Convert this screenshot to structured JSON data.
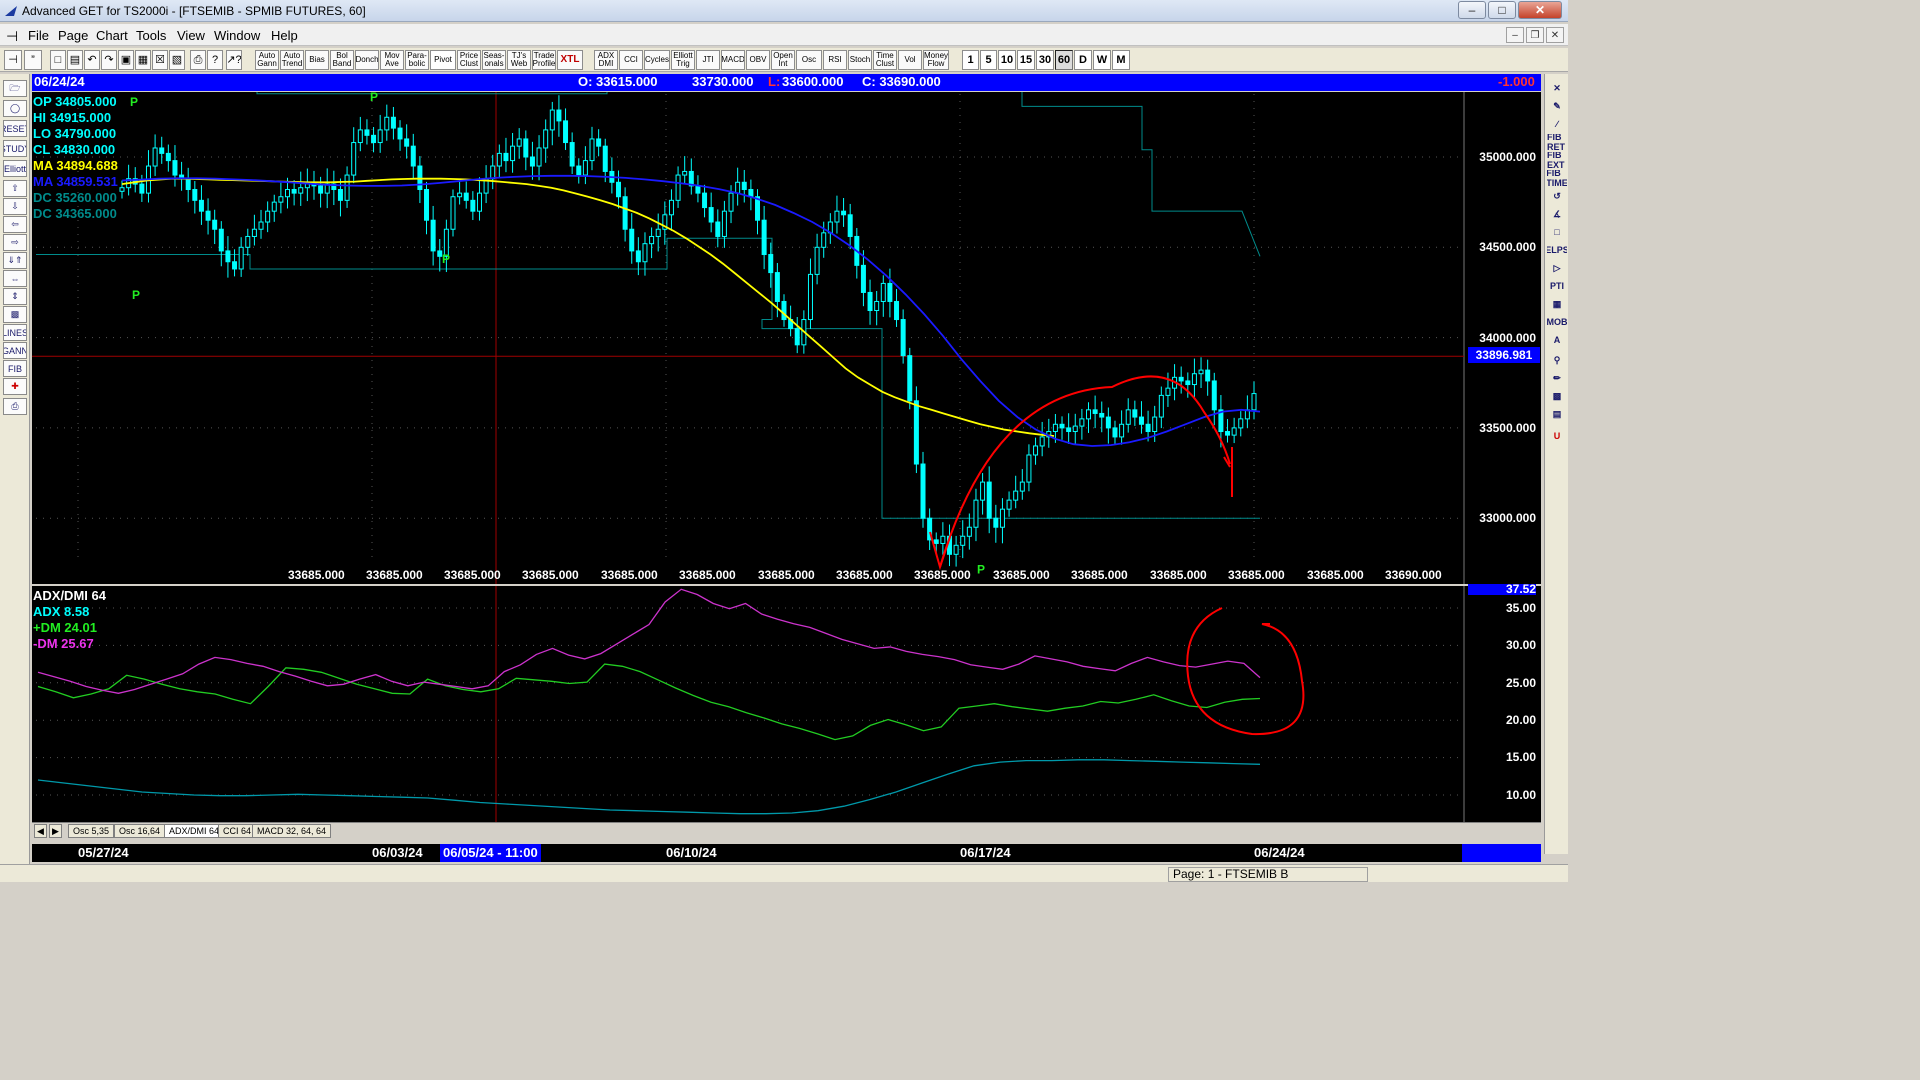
{
  "window": {
    "title": "Advanced GET for TS2000i - [FTSEMIB - SPMIB FUTURES, 60]",
    "controls": [
      "minimize",
      "maximize",
      "close"
    ]
  },
  "menu": {
    "items": [
      "File",
      "Page",
      "Chart",
      "Tools",
      "View",
      "Window",
      "Help"
    ]
  },
  "toolbar": {
    "study_buttons": [
      "Auto Gann",
      "Auto Trend",
      "Bias",
      "Bol Band",
      "Donch",
      "Mov Ave",
      "Para-bolic",
      "Pivot",
      "Price Clust",
      "Seas-onals",
      "TJ's Web",
      "Trade Profile",
      "XTL",
      "ADX DMI",
      "CCI",
      "Cycles",
      "Elliott Trig",
      "JTI",
      "MACD",
      "OBV",
      "Open Int",
      "Osc",
      "RSI",
      "Stoch",
      "Time Clust",
      "Vol",
      "Money Flow"
    ],
    "timeframes": [
      "1",
      "5",
      "10",
      "15",
      "30",
      "60",
      "D",
      "W",
      "M"
    ],
    "active_timeframe": "60"
  },
  "chart_header": {
    "date": "06/24/24",
    "open": "O: 33615.000",
    "high": "33730.000",
    "low_prefix": "L:",
    "low": "33600.000",
    "close": "C: 33690.000",
    "change": "-1.000"
  },
  "price_legend": [
    {
      "label": "OP  34805.000",
      "color": "#00ffff"
    },
    {
      "label": "HI   34915.000",
      "color": "#00ffff"
    },
    {
      "label": "LO   34790.000",
      "color": "#00ffff"
    },
    {
      "label": "CL   34830.000",
      "color": "#00ffff"
    },
    {
      "label": "MA  34894.688",
      "color": "#ffff00"
    },
    {
      "label": "MA  34859.531",
      "color": "#1a1aff"
    },
    {
      "label": "DC  35260.000",
      "color": "#008b8b"
    },
    {
      "label": "DC  34365.000",
      "color": "#008b8b"
    }
  ],
  "price_axis": {
    "labels": [
      "35000.000",
      "34500.000",
      "34000.000",
      "33500.000",
      "33000.000"
    ],
    "cursor_value": "33896.981"
  },
  "price_bottom_labels": [
    "33685.000",
    "33685.000",
    "33685.000",
    "33685.000",
    "33685.000",
    "33685.000",
    "33685.000",
    "33685.000",
    "33685.000",
    "33685.000",
    "33685.000",
    "33685.000",
    "33685.000",
    "33685.000",
    "33685.000",
    "33690.000"
  ],
  "pivot_marker": "P",
  "indicator": {
    "title": "ADX/DMI 64",
    "adx_label": "ADX 8.58",
    "pdm_label": "+DM 24.01",
    "mdm_label": "-DM  25.67",
    "top_value": "37.52",
    "axis_labels": [
      "35.00",
      "30.00",
      "25.00",
      "20.00",
      "15.00",
      "10.00"
    ]
  },
  "tabs": [
    "Osc 5,35",
    "Osc 16,64",
    "ADX/DMI 64",
    "CCI 64",
    "MACD 32, 64, 64"
  ],
  "active_tab": "ADX/DMI 64",
  "dates": {
    "labels": [
      "05/27/24",
      "06/03/24",
      "06/10/24",
      "06/17/24",
      "06/24/24"
    ],
    "cursor": "06/05/24 - 11:00"
  },
  "status": {
    "page": "Page: 1 - FTSEMIB B"
  },
  "colors": {
    "chart_bg": "#000000",
    "header_bg": "#0000ff",
    "candles": "#00ffff",
    "ma_fast": "#ffff00",
    "ma_slow": "#1a1aff",
    "donchian": "#008b8b",
    "plus_dm": "#22cc22",
    "minus_dm": "#cc33cc",
    "adx": "#0099aa",
    "annotation": "#ff0000"
  },
  "chart_data": [
    {
      "type": "candlestick",
      "title": "FTSEMIB - SPMIB FUTURES, 60",
      "ylim": [
        32700,
        35500
      ],
      "yticks": [
        33000,
        33500,
        34000,
        34500,
        35000
      ],
      "xticks": [
        "05/27/24",
        "06/03/24",
        "06/10/24",
        "06/17/24",
        "06/24/24"
      ],
      "series": [
        {
          "name": "Close",
          "values": [
            34830,
            34880,
            34850,
            34800,
            34950,
            35050,
            35020,
            34980,
            34900,
            34880,
            34820,
            34760,
            34700,
            34650,
            34600,
            34480,
            34420,
            34380,
            34500,
            34560,
            34600,
            34640,
            34700,
            34750,
            34780,
            34820,
            34800,
            34830,
            34860,
            34840,
            34800,
            34850,
            34820,
            34760,
            34900,
            35080,
            35150,
            35120,
            35080,
            35150,
            35220,
            35160,
            35100,
            35060,
            34950,
            34820,
            34650,
            34480,
            34450,
            34600,
            34780,
            34800,
            34760,
            34700,
            34800,
            34880,
            34950,
            35020,
            34980,
            35060,
            35100,
            35000,
            34950,
            35050,
            35150,
            35260,
            35200,
            35080,
            34950,
            34900,
            34980,
            35100,
            35060,
            34920,
            34860,
            34780,
            34600,
            34480,
            34420,
            34520,
            34560,
            34600,
            34680,
            34760,
            34900,
            34920,
            34840,
            34800,
            34720,
            34640,
            34560,
            34700,
            34800,
            34860,
            34820,
            34780,
            34650,
            34460,
            34360,
            34200,
            34100,
            34050,
            33960,
            34100,
            34350,
            34500,
            34580,
            34640,
            34700,
            34680,
            34560,
            34400,
            34250,
            34150,
            34200,
            34300,
            34200,
            34100,
            33900,
            33650,
            33300,
            33000,
            32880,
            32860,
            32900,
            32800,
            32850,
            32900,
            32950,
            33100,
            33200,
            33000,
            32950,
            33050,
            33100,
            33150,
            33200,
            33350,
            33400,
            33450,
            33480,
            33520,
            33500,
            33480,
            33510,
            33550,
            33600,
            33580,
            33560,
            33500,
            33450,
            33520,
            33600,
            33560,
            33520,
            33480,
            33560,
            33680,
            33720,
            33780,
            33760,
            33740,
            33800,
            33820,
            33760,
            33600,
            33480,
            33460,
            33500,
            33550,
            33600,
            33690
          ]
        },
        {
          "name": "MA 34894.688",
          "values": [
            34850,
            34860,
            34870,
            34875,
            34880,
            34880,
            34878,
            34876,
            34874,
            34872,
            34870,
            34868,
            34866,
            34864,
            34862,
            34860,
            34860,
            34860,
            34862,
            34864,
            34868,
            34872,
            34876,
            34878,
            34880,
            34880,
            34880,
            34878,
            34876,
            34872,
            34868,
            34862,
            34856,
            34850,
            34840,
            34830,
            34815,
            34798,
            34780,
            34760,
            34740,
            34715,
            34690,
            34660,
            34625,
            34590,
            34550,
            34505,
            34460,
            34410,
            34355,
            34300,
            34245,
            34190,
            34130,
            34070,
            34010,
            33950,
            33890,
            33830,
            33780,
            33740,
            33700,
            33670,
            33645,
            33620,
            33600,
            33580,
            33560,
            33540,
            33520,
            33505,
            33490,
            33480,
            33470,
            33462,
            33455
          ]
        },
        {
          "name": "MA 34859.531",
          "values": [
            34870,
            34875,
            34880,
            34882,
            34882,
            34880,
            34876,
            34872,
            34866,
            34860,
            34852,
            34846,
            34842,
            34840,
            34840,
            34842,
            34848,
            34856,
            34866,
            34876,
            34884,
            34890,
            34894,
            34896,
            34896,
            34894,
            34890,
            34884,
            34876,
            34866,
            34854,
            34840,
            34822,
            34800,
            34770,
            34735,
            34690,
            34640,
            34580,
            34510,
            34430,
            34340,
            34240,
            34130,
            34010,
            33880,
            33760,
            33650,
            33560,
            33490,
            33440,
            33410,
            33400,
            33405,
            33420,
            33445,
            33480,
            33520,
            33560,
            33590,
            33600,
            33590
          ]
        }
      ]
    },
    {
      "type": "line",
      "title": "ADX/DMI 64",
      "ylim": [
        7,
        37.52
      ],
      "yticks": [
        10,
        15,
        20,
        25,
        30,
        35
      ],
      "series": [
        {
          "name": "+DM 24.01",
          "values": [
            24.5,
            23.8,
            23,
            23.5,
            24.2,
            26,
            25.5,
            24.8,
            24.2,
            23.8,
            23.5,
            22.8,
            22.2,
            24.5,
            27,
            26.8,
            26.4,
            25.6,
            24.8,
            24.2,
            23.6,
            23.5,
            25.5,
            24.6,
            24.1,
            23.8,
            24.2,
            25.6,
            25.4,
            25.2,
            24.9,
            25.1,
            27.5,
            27.2,
            26.5,
            25.4,
            24.3,
            23.3,
            22.4,
            21.8,
            21,
            20.3,
            19.5,
            18.9,
            18.2,
            17.4,
            17.9,
            19.3,
            20.1,
            19.4,
            18.6,
            19.1,
            21.6,
            21.9,
            22.2,
            21.8,
            21.5,
            21.2,
            21.6,
            21.9,
            22.5,
            22.3,
            22.8,
            23.4,
            22.6,
            21.9,
            21.7,
            22.4,
            22.8,
            22.9
          ]
        },
        {
          "name": "-DM  25.67",
          "values": [
            26.4,
            25.8,
            25.2,
            24.5,
            24,
            23.6,
            24.1,
            24.8,
            25.5,
            26.2,
            27.5,
            28.4,
            28.1,
            27.6,
            27.2,
            26.5,
            25.9,
            25.2,
            24.6,
            24.8,
            25.5,
            26.1,
            25.2,
            24.6,
            25.1,
            24.8,
            24.5,
            24.2,
            24.6,
            26.5,
            27.4,
            28.8,
            29.6,
            28.7,
            28.2,
            28.9,
            30.2,
            31.5,
            32.8,
            35.8,
            37.5,
            36.8,
            35.6,
            34.9,
            35.6,
            34.2,
            33.5,
            32.9,
            32.4,
            31.6,
            30.8,
            30.2,
            29.6,
            29.8,
            29.2,
            28.8,
            28.5,
            28.1,
            27.4,
            27.1,
            26.8,
            27.5,
            28.6,
            28.2,
            27.8,
            27.2,
            26.9,
            26.6,
            27.6,
            28.4,
            27.8,
            27.3,
            27.1,
            27.5,
            27.9,
            27.6,
            25.7
          ]
        },
        {
          "name": "ADX 8.58",
          "values": [
            12,
            11.6,
            11.2,
            10.8,
            10.4,
            10.2,
            10,
            9.9,
            9.9,
            10,
            10.1,
            10,
            9.9,
            9.8,
            9.7,
            9.6,
            9.3,
            9,
            8.8,
            8.6,
            8.4,
            8.2,
            8,
            7.9,
            7.8,
            7.7,
            7.6,
            7.5,
            7.5,
            7.6,
            7.9,
            8.5,
            9.4,
            10.4,
            11.6,
            12.8,
            13.9,
            14.4,
            14.6,
            14.6,
            14.7,
            14.7,
            14.6,
            14.5,
            14.4,
            14.3,
            14.2,
            14.1
          ]
        }
      ]
    }
  ]
}
